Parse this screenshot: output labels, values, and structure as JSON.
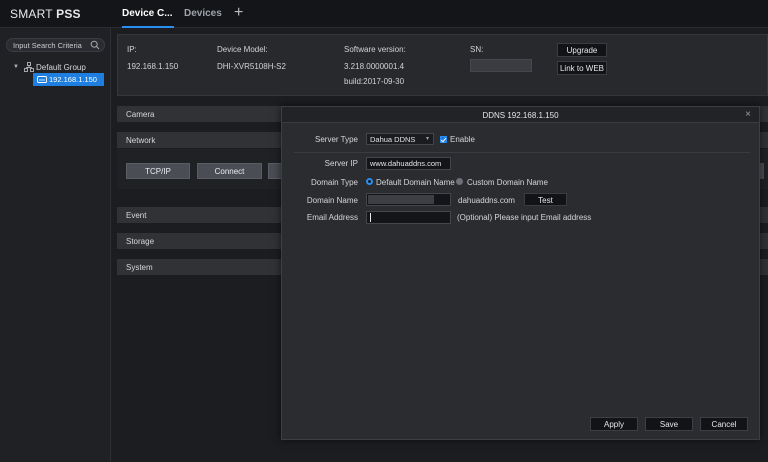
{
  "app": {
    "logo_regular": "SMART ",
    "logo_bold": "PSS"
  },
  "tabs": [
    {
      "label": "Device C..."
    },
    {
      "label": "Devices"
    }
  ],
  "sidebar": {
    "search_placeholder": "Input Search Criteria",
    "group_label": "Default Group",
    "device_label": "192.168.1.150"
  },
  "device_info": {
    "ip_label": "IP:",
    "ip_value": "192.168.1.150",
    "model_label": "Device Model:",
    "model_value": "DHI-XVR5108H-S2",
    "software_label": "Software version:",
    "software_value": "3.218.0000001.4",
    "build_value": "build:2017-09-30",
    "sn_label": "SN:",
    "upgrade_button": "Upgrade",
    "link_web_button": "Link to WEB"
  },
  "sections": {
    "camera": "Camera",
    "network": "Network",
    "event": "Event",
    "storage": "Storage",
    "system": "System"
  },
  "network_buttons": {
    "tcpip": "TCP/IP",
    "connect": "Connect"
  },
  "dialog": {
    "title": "DDNS 192.168.1.150",
    "close": "×",
    "server_type_label": "Server Type",
    "server_type_value": "Dahua DDNS",
    "enable_label": "Enable",
    "server_ip_label": "Server IP",
    "server_ip_value": "www.dahuaddns.com",
    "domain_type_label": "Domain Type",
    "default_domain": "Default Domain Name",
    "custom_domain": "Custom Domain Name",
    "domain_name_label": "Domain Name",
    "domain_suffix": "dahuaddns.com",
    "test_button": "Test",
    "email_label": "Email Address",
    "email_hint": "(Optional) Please input Email address",
    "apply_button": "Apply",
    "save_button": "Save",
    "cancel_button": "Cancel"
  },
  "colors": {
    "accent": "#1e7fe0",
    "background": "#1c1d20"
  }
}
